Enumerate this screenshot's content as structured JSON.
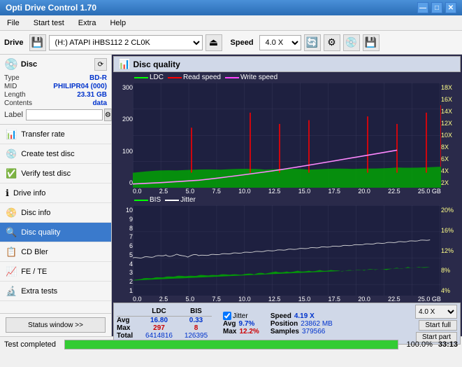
{
  "app": {
    "title": "Opti Drive Control 1.70",
    "min_btn": "—",
    "max_btn": "□",
    "close_btn": "✕"
  },
  "menu": {
    "items": [
      "File",
      "Start test",
      "Extra",
      "Help"
    ]
  },
  "toolbar": {
    "drive_label": "Drive",
    "drive_value": "(H:)  ATAPI  iHBS112  2 CL0K",
    "speed_label": "Speed",
    "speed_value": "4.0 X"
  },
  "disc": {
    "title": "Disc",
    "type_label": "Type",
    "type_value": "BD-R",
    "mid_label": "MID",
    "mid_value": "PHILIPR04 (000)",
    "length_label": "Length",
    "length_value": "23.31 GB",
    "contents_label": "Contents",
    "contents_value": "data",
    "label_label": "Label",
    "label_placeholder": ""
  },
  "nav": {
    "items": [
      {
        "id": "transfer-rate",
        "label": "Transfer rate",
        "icon": "📊"
      },
      {
        "id": "create-test-disc",
        "label": "Create test disc",
        "icon": "💿"
      },
      {
        "id": "verify-test-disc",
        "label": "Verify test disc",
        "icon": "✅"
      },
      {
        "id": "drive-info",
        "label": "Drive info",
        "icon": "ℹ️"
      },
      {
        "id": "disc-info",
        "label": "Disc info",
        "icon": "📀"
      },
      {
        "id": "disc-quality",
        "label": "Disc quality",
        "icon": "🔍",
        "active": true
      },
      {
        "id": "cd-bler",
        "label": "CD Bler",
        "icon": "📋"
      },
      {
        "id": "fe-te",
        "label": "FE / TE",
        "icon": "📈"
      },
      {
        "id": "extra-tests",
        "label": "Extra tests",
        "icon": "🔬"
      }
    ]
  },
  "chart": {
    "title": "Disc quality",
    "top_legend": [
      {
        "label": "LDC",
        "color": "#00ff00"
      },
      {
        "label": "Read speed",
        "color": "#ff0000"
      },
      {
        "label": "Write speed",
        "color": "#ff44ff"
      }
    ],
    "bottom_legend": [
      {
        "label": "BIS",
        "color": "#00ff00"
      },
      {
        "label": "Jitter",
        "color": "#ffffff"
      }
    ],
    "top_y_left": [
      "300",
      "200",
      "100",
      "0"
    ],
    "top_y_right": [
      "18X",
      "16X",
      "14X",
      "12X",
      "10X",
      "8X",
      "6X",
      "4X",
      "2X"
    ],
    "bottom_y_left": [
      "10",
      "9",
      "8",
      "7",
      "6",
      "5",
      "4",
      "3",
      "2",
      "1"
    ],
    "bottom_y_right": [
      "20%",
      "16%",
      "12%",
      "8%",
      "4%"
    ],
    "x_labels": [
      "0.0",
      "2.5",
      "5.0",
      "7.5",
      "10.0",
      "12.5",
      "15.0",
      "17.5",
      "20.0",
      "22.5",
      "25.0 GB"
    ]
  },
  "stats": {
    "col_ldc": "LDC",
    "col_bis": "BIS",
    "row_avg": "Avg",
    "row_max": "Max",
    "row_total": "Total",
    "avg_ldc": "16.80",
    "avg_bis": "0.33",
    "max_ldc": "297",
    "max_bis": "8",
    "total_ldc": "6414816",
    "total_bis": "126395",
    "jitter_label": "Jitter",
    "jitter_avg": "9.7%",
    "jitter_max": "12.2%",
    "speed_label": "Speed",
    "speed_value": "4.19 X",
    "position_label": "Position",
    "position_value": "23862 MB",
    "samples_label": "Samples",
    "samples_value": "379566",
    "speed_dropdown": "4.0 X",
    "start_full_btn": "Start full",
    "start_part_btn": "Start part"
  },
  "status": {
    "status_window_btn": "Status window >>",
    "status_text": "Test completed",
    "progress_pct": 100,
    "time": "33:13"
  }
}
